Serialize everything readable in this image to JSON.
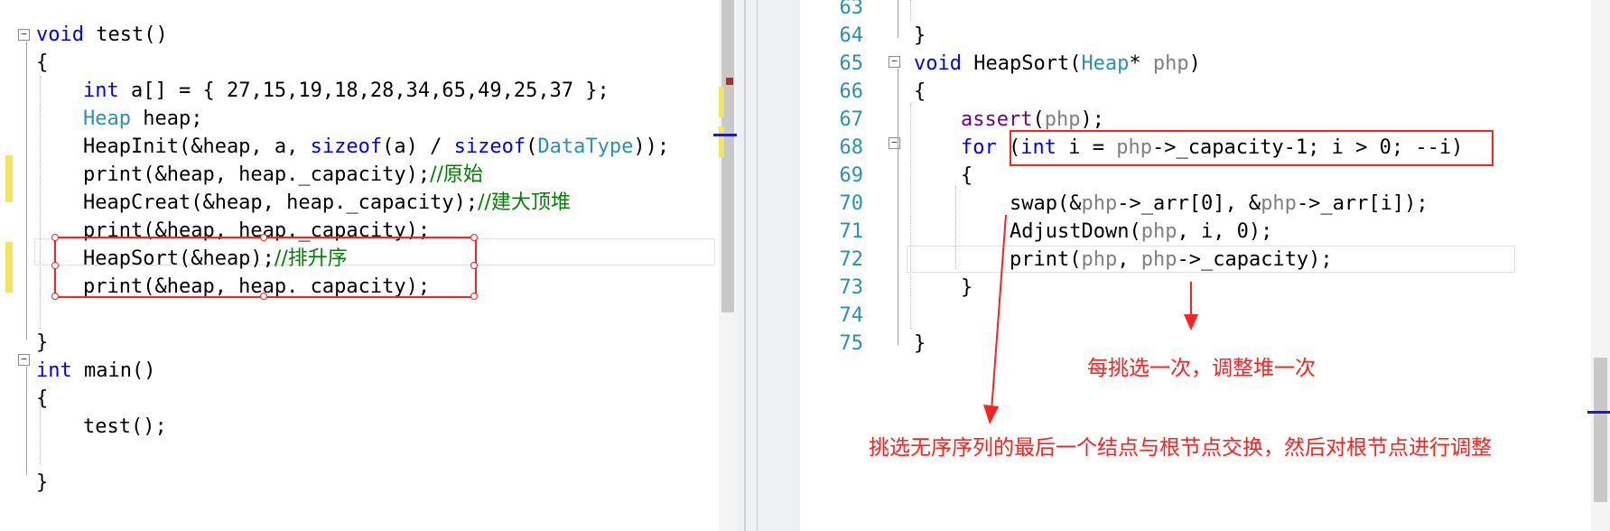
{
  "left_code": [
    {
      "tokens": [
        {
          "t": "void",
          "c": "kw"
        },
        {
          "t": " test()",
          "c": "fn"
        }
      ]
    },
    {
      "tokens": [
        {
          "t": "{",
          "c": "fn"
        }
      ]
    },
    {
      "tokens": [
        {
          "t": "int",
          "c": "kw"
        },
        {
          "t": " a[] = { 27,15,19,18,28,34,65,49,25,37 };",
          "c": "fn"
        }
      ]
    },
    {
      "tokens": [
        {
          "t": "Heap",
          "c": "type"
        },
        {
          "t": " heap;",
          "c": "fn"
        }
      ]
    },
    {
      "tokens": [
        {
          "t": "HeapInit(&heap, a, ",
          "c": "fn"
        },
        {
          "t": "sizeof",
          "c": "kw"
        },
        {
          "t": "(a) / ",
          "c": "fn"
        },
        {
          "t": "sizeof",
          "c": "kw"
        },
        {
          "t": "(",
          "c": "fn"
        },
        {
          "t": "DataType",
          "c": "type"
        },
        {
          "t": "));",
          "c": "fn"
        }
      ]
    },
    {
      "tokens": [
        {
          "t": "print(&heap, heap._capacity);",
          "c": "fn"
        },
        {
          "t": "//原始",
          "c": "cm"
        }
      ]
    },
    {
      "tokens": [
        {
          "t": "HeapCreat(&heap, heap._capacity);",
          "c": "fn"
        },
        {
          "t": "//建大顶堆",
          "c": "cm"
        }
      ]
    },
    {
      "tokens": [
        {
          "t": "print(&heap, heap._capacity);",
          "c": "fn"
        }
      ]
    },
    {
      "tokens": [
        {
          "t": "HeapSort(&heap);",
          "c": "fn"
        },
        {
          "t": "//排升序",
          "c": "cm"
        }
      ]
    },
    {
      "tokens": [
        {
          "t": "print(&heap, heap._capacity);",
          "c": "fn"
        }
      ]
    },
    {
      "tokens": []
    },
    {
      "tokens": [
        {
          "t": "}",
          "c": "fn"
        }
      ]
    },
    {
      "tokens": [
        {
          "t": "int",
          "c": "kw"
        },
        {
          "t": " main()",
          "c": "fn"
        }
      ]
    },
    {
      "tokens": [
        {
          "t": "{",
          "c": "fn"
        }
      ]
    },
    {
      "tokens": [
        {
          "t": "test();",
          "c": "fn"
        }
      ]
    },
    {
      "tokens": []
    },
    {
      "tokens": [
        {
          "t": "}",
          "c": "fn"
        }
      ]
    }
  ],
  "right_line_numbers": [
    "63",
    "64",
    "65",
    "66",
    "67",
    "68",
    "69",
    "70",
    "71",
    "72",
    "73",
    "74",
    "75"
  ],
  "right_code": [
    {
      "tokens": []
    },
    {
      "tokens": [
        {
          "t": "}",
          "c": "fn"
        }
      ]
    },
    {
      "tokens": [
        {
          "t": "void",
          "c": "kw"
        },
        {
          "t": " HeapSort(",
          "c": "fn"
        },
        {
          "t": "Heap",
          "c": "type"
        },
        {
          "t": "* ",
          "c": "fn"
        },
        {
          "t": "php",
          "c": "param"
        },
        {
          "t": ")",
          "c": "fn"
        }
      ]
    },
    {
      "tokens": [
        {
          "t": "{",
          "c": "fn"
        }
      ]
    },
    {
      "tokens": [
        {
          "t": "assert",
          "c": "macro"
        },
        {
          "t": "(",
          "c": "fn"
        },
        {
          "t": "php",
          "c": "param"
        },
        {
          "t": ");",
          "c": "fn"
        }
      ]
    },
    {
      "tokens": [
        {
          "t": "for",
          "c": "kw"
        },
        {
          "t": " (",
          "c": "fn"
        },
        {
          "t": "int",
          "c": "kw"
        },
        {
          "t": " i = ",
          "c": "fn"
        },
        {
          "t": "php",
          "c": "param"
        },
        {
          "t": "->_capacity-1; i > 0; --i)",
          "c": "fn"
        }
      ]
    },
    {
      "tokens": [
        {
          "t": "{",
          "c": "fn"
        }
      ]
    },
    {
      "tokens": [
        {
          "t": "swap(&",
          "c": "fn"
        },
        {
          "t": "php",
          "c": "param"
        },
        {
          "t": "->_arr[0], &",
          "c": "fn"
        },
        {
          "t": "php",
          "c": "param"
        },
        {
          "t": "->_arr[i]);",
          "c": "fn"
        }
      ]
    },
    {
      "tokens": [
        {
          "t": "AdjustDown(",
          "c": "fn"
        },
        {
          "t": "php",
          "c": "param"
        },
        {
          "t": ", i, 0);",
          "c": "fn"
        }
      ]
    },
    {
      "tokens": [
        {
          "t": "print(",
          "c": "fn"
        },
        {
          "t": "php",
          "c": "param"
        },
        {
          "t": ", ",
          "c": "fn"
        },
        {
          "t": "php",
          "c": "param"
        },
        {
          "t": "->_capacity);",
          "c": "fn"
        }
      ]
    },
    {
      "tokens": [
        {
          "t": "}",
          "c": "fn"
        }
      ]
    },
    {
      "tokens": []
    },
    {
      "tokens": [
        {
          "t": "}",
          "c": "fn"
        }
      ]
    }
  ],
  "annotations": {
    "adjust_each": "每挑选一次，调整堆一次",
    "swap_explain": "挑选无序序列的最后一个结点与根节点交换，然后对根节点进行调整"
  },
  "colors": {
    "keyword": "#0000ff",
    "type": "#2b91af",
    "comment": "#008000",
    "annotation": "#ff2020",
    "line_number": "#2b91af"
  }
}
